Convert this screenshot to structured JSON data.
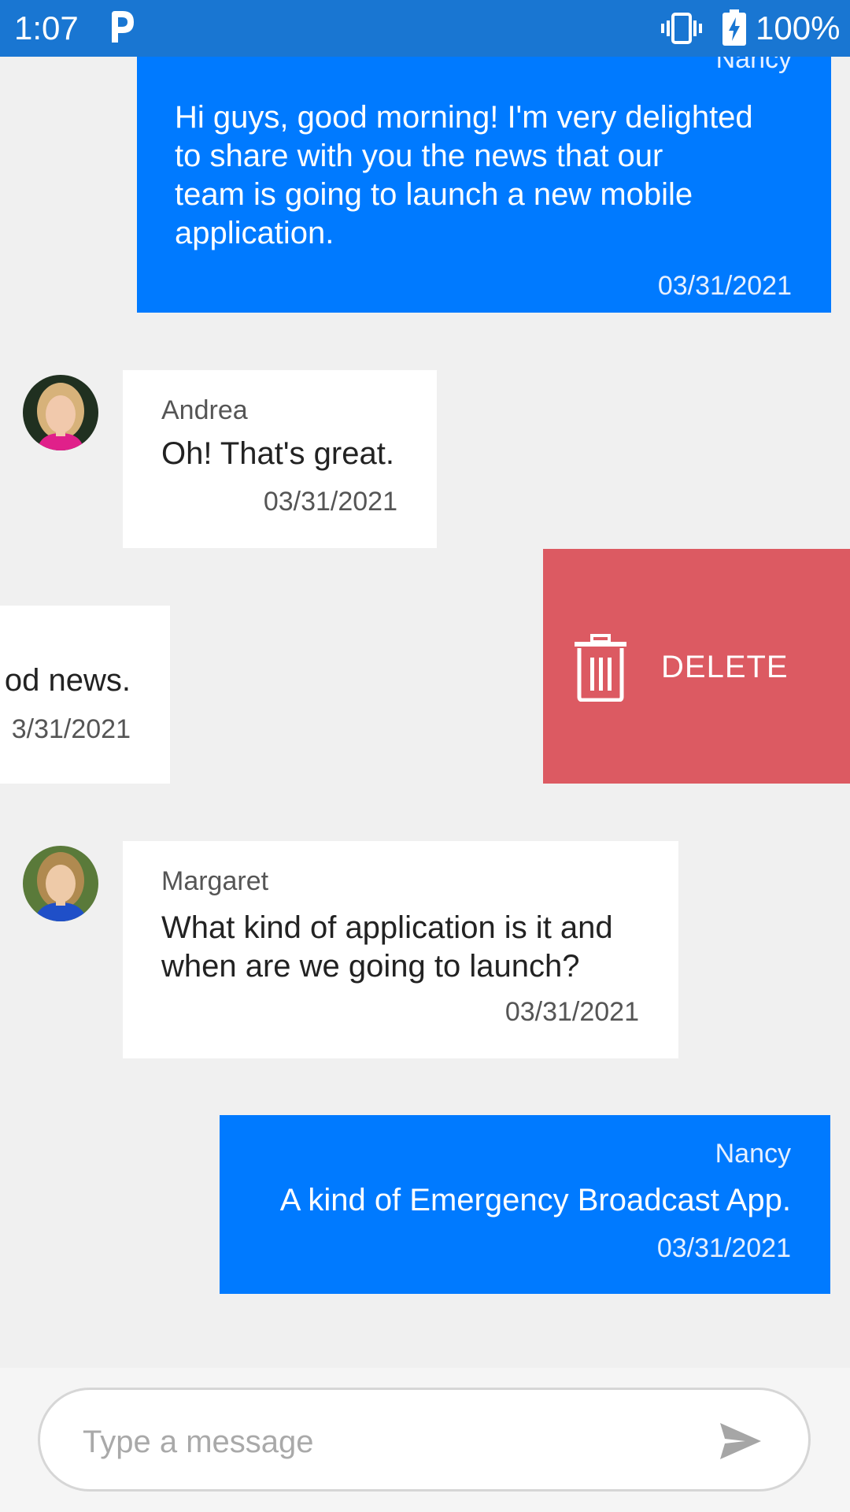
{
  "status_bar": {
    "time": "1:07",
    "battery_percent": "100%",
    "colors": {
      "background": "#1976d2"
    }
  },
  "messages": [
    {
      "direction": "outgoing",
      "sender": "Nancy",
      "lines": [
        "Hi guys, good morning! I'm very delighted",
        "to share with you the news that our",
        "team is going to launch a new mobile",
        "application."
      ],
      "date": "03/31/2021"
    },
    {
      "direction": "incoming",
      "sender": "Andrea",
      "text": "Oh! That's great.",
      "date": "03/31/2021"
    },
    {
      "direction": "incoming",
      "swiped": true,
      "text_visible": "od news.",
      "date_visible": "3/31/2021"
    },
    {
      "direction": "incoming",
      "sender": "Margaret",
      "lines": [
        "What kind of application is it and",
        "when are we going to launch?"
      ],
      "date": "03/31/2021"
    },
    {
      "direction": "outgoing",
      "sender": "Nancy",
      "text": "A kind of Emergency Broadcast App.",
      "date": "03/31/2021"
    }
  ],
  "swipe_action": {
    "label": "DELETE",
    "icon": "trash-icon",
    "color": "#dc5a62"
  },
  "composer": {
    "placeholder": "Type a message",
    "value": "",
    "send_icon": "send-icon"
  },
  "colors": {
    "outgoing_bubble": "#007aff",
    "incoming_bubble": "#ffffff",
    "background": "#f0f0f0"
  }
}
